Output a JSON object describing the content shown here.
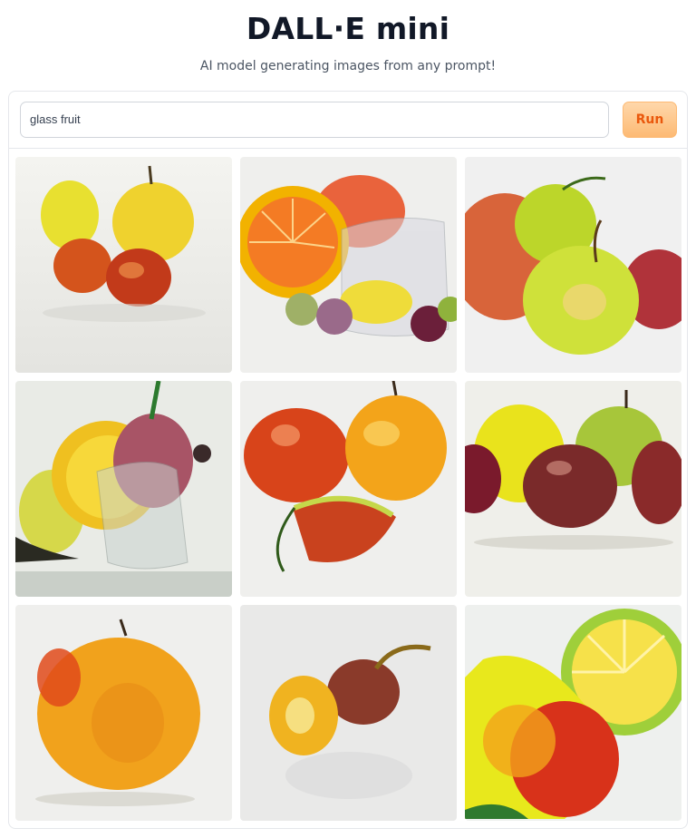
{
  "header": {
    "title": "DALL·E mini",
    "subtitle": "AI model generating images from any prompt!"
  },
  "prompt": {
    "value": "glass fruit"
  },
  "run_button": {
    "label": "Run"
  },
  "gallery": {
    "images": [
      {
        "name": "generated-image-1"
      },
      {
        "name": "generated-image-2"
      },
      {
        "name": "generated-image-3"
      },
      {
        "name": "generated-image-4"
      },
      {
        "name": "generated-image-5"
      },
      {
        "name": "generated-image-6"
      },
      {
        "name": "generated-image-7"
      },
      {
        "name": "generated-image-8"
      },
      {
        "name": "generated-image-9"
      }
    ]
  },
  "colors": {
    "accent": "#fdba74",
    "accent_text": "#ea580c",
    "border": "#e5e7eb"
  }
}
